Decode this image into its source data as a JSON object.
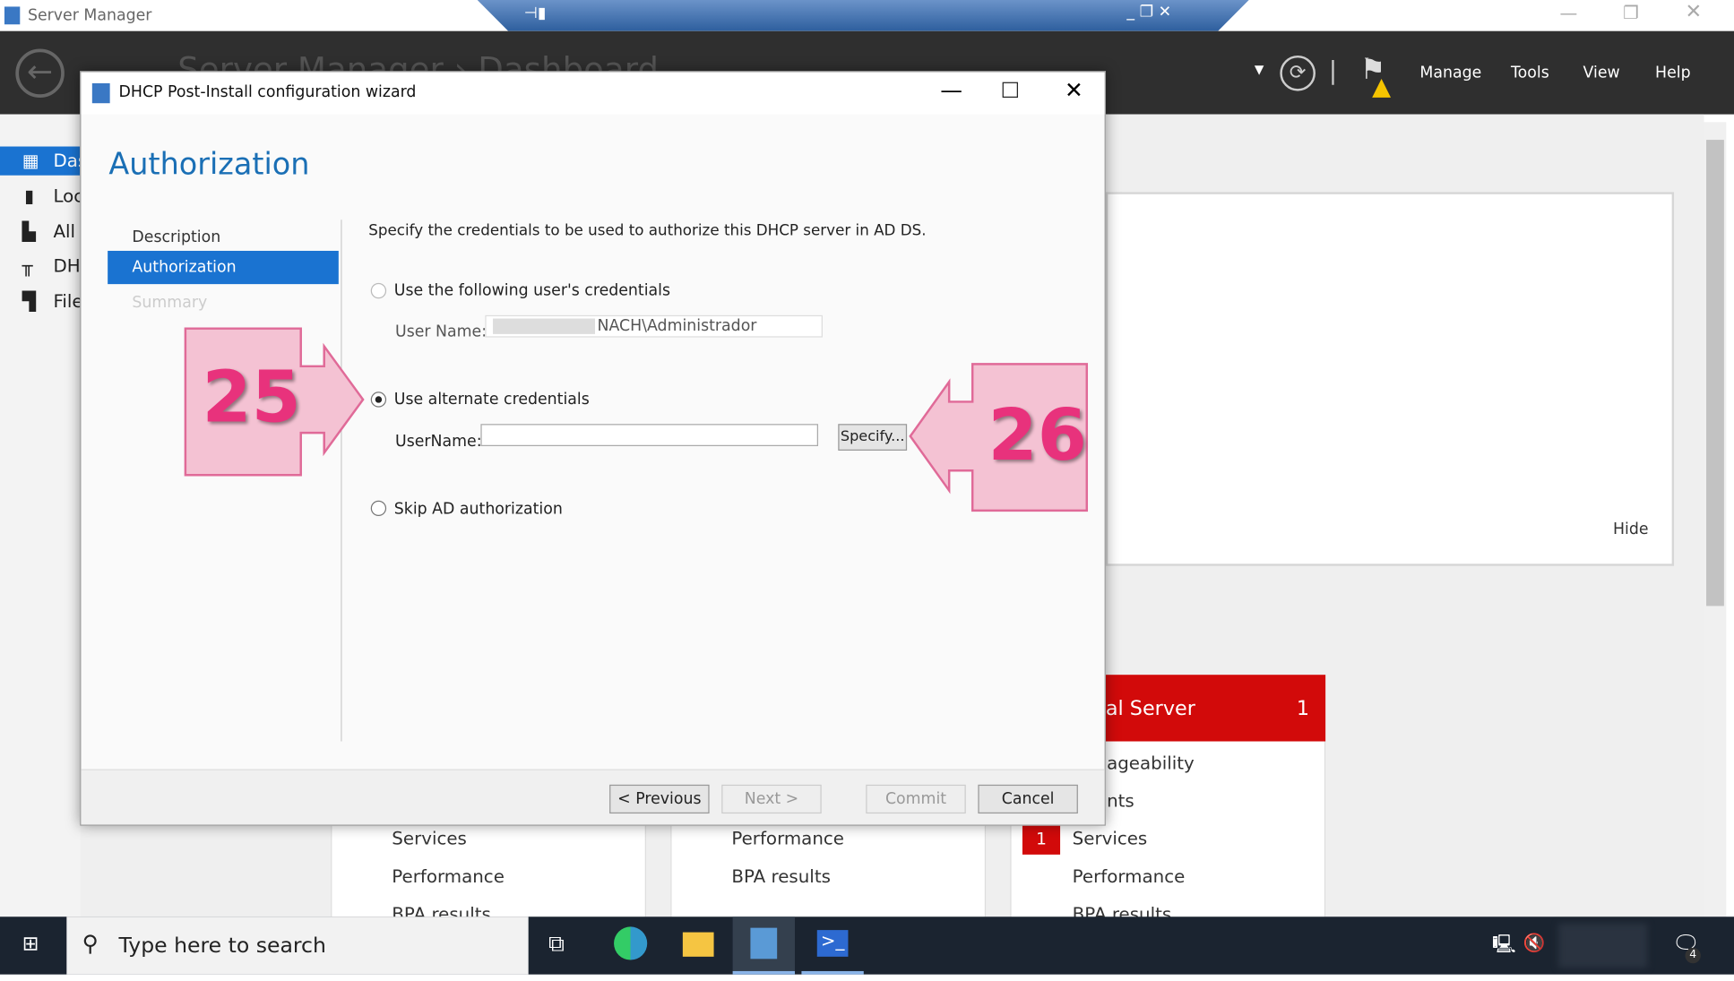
{
  "window": {
    "title": "Server Manager",
    "breadcrumb": "Server Manager › Dashboard"
  },
  "header": {
    "menu": [
      "Manage",
      "Tools",
      "View",
      "Help"
    ],
    "icons": [
      "refresh-icon",
      "flag-warning-icon"
    ]
  },
  "nav": {
    "items": [
      "Dashboard",
      "Local Server",
      "All Servers",
      "DHCP",
      "File and Storage Services"
    ],
    "visible": [
      "Das",
      "Loc",
      "All",
      "DH",
      "File"
    ],
    "active": 0
  },
  "background": {
    "hide_label": "Hide",
    "tile_title": "al Server",
    "tile_count": "1",
    "tile_items": [
      "ageability",
      "nts",
      "Services",
      "Performance",
      "BPA results"
    ],
    "services_badge": "1",
    "col1": [
      "Services",
      "Performance",
      "BPA results"
    ],
    "col2": [
      "Performance",
      "BPA results"
    ]
  },
  "dialog": {
    "title": "DHCP Post-Install configuration wizard",
    "heading": "Authorization",
    "steps": [
      "Description",
      "Authorization",
      "Summary"
    ],
    "active_step": 1,
    "instruction": "Specify the credentials to be used to authorize this DHCP server in AD DS.",
    "option1": "Use the following user's credentials",
    "user_name_label": "User Name:",
    "user_name_value": "NACH\\Administrador",
    "option2": "Use alternate credentials",
    "alt_username_label": "UserName:",
    "alt_username_value": "",
    "specify_label": "Specify...",
    "option3": "Skip AD authorization",
    "selected_option": 2,
    "buttons": {
      "previous": "< Previous",
      "next": "Next >",
      "commit": "Commit",
      "cancel": "Cancel"
    }
  },
  "annotations": [
    "25",
    "26"
  ],
  "annotation_color": "#e8327c",
  "taskbar": {
    "search_placeholder": "Type here to search",
    "notification_count": "4"
  }
}
